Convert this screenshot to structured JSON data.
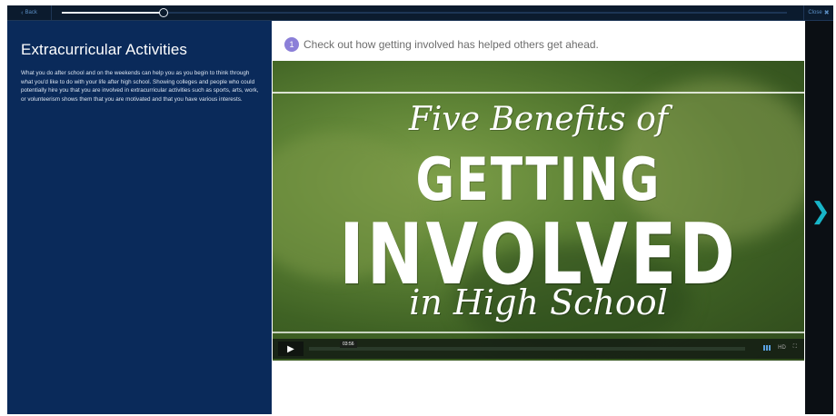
{
  "topbar": {
    "back_label": "Back",
    "close_label": "Close",
    "progress_fraction": 0.14
  },
  "left": {
    "title": "Extracurricular Activities",
    "body": "What you do after school and on the weekends can help you as you begin to think through what you'd like to do with your life after high school. Showing colleges and people who could potentially hire you that you are involved in extracurricular activities such as sports, arts, work, or volunteerism shows them that you are motivated and that you have various interests."
  },
  "content": {
    "step_number": "1",
    "step_text": "Check out how getting involved has helped others get ahead."
  },
  "video": {
    "line1": "Five Benefits of",
    "line2": "GETTING",
    "line3": "INVOLVED",
    "line4": "in High School",
    "time_display": "03:56",
    "quality_label": "HD"
  },
  "colors": {
    "left_panel": "#0a2a5a",
    "step_badge": "#8b7fd8",
    "next_arrow": "#18b5c8"
  }
}
